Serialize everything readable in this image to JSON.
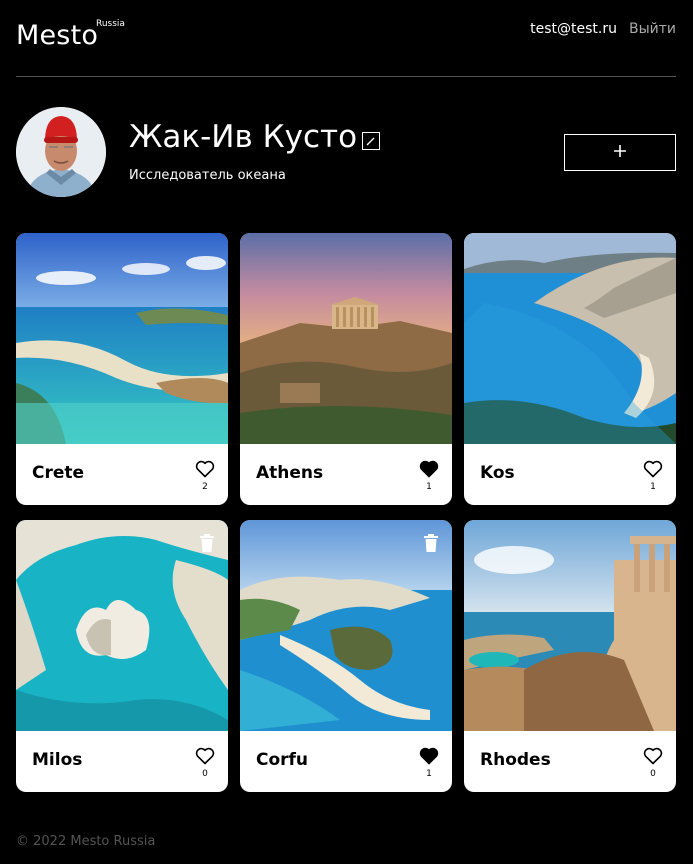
{
  "header": {
    "logo": "Mesto",
    "logo_sup": "Russia",
    "email": "test@test.ru",
    "logout": "Выйти"
  },
  "profile": {
    "name": "Жак-Ив Кусто",
    "about": "Исследователь океана",
    "add_label": "+"
  },
  "cards": [
    {
      "title": "Crete",
      "likes": "2",
      "liked": false,
      "deletable": false
    },
    {
      "title": "Athens",
      "likes": "1",
      "liked": true,
      "deletable": false
    },
    {
      "title": "Kos",
      "likes": "1",
      "liked": false,
      "deletable": false
    },
    {
      "title": "Milos",
      "likes": "0",
      "liked": false,
      "deletable": true
    },
    {
      "title": "Corfu",
      "likes": "1",
      "liked": true,
      "deletable": true
    },
    {
      "title": "Rhodes",
      "likes": "0",
      "liked": false,
      "deletable": false
    }
  ],
  "footer": {
    "copyright": "© 2022 Mesto Russia"
  },
  "icons": {
    "heart": "heart-icon",
    "trash": "trash-icon",
    "edit": "pencil-icon",
    "add": "plus-icon"
  },
  "colors": {
    "background": "#000000",
    "card": "#ffffff",
    "divider": "#545454",
    "muted": "#a9a9a9"
  }
}
